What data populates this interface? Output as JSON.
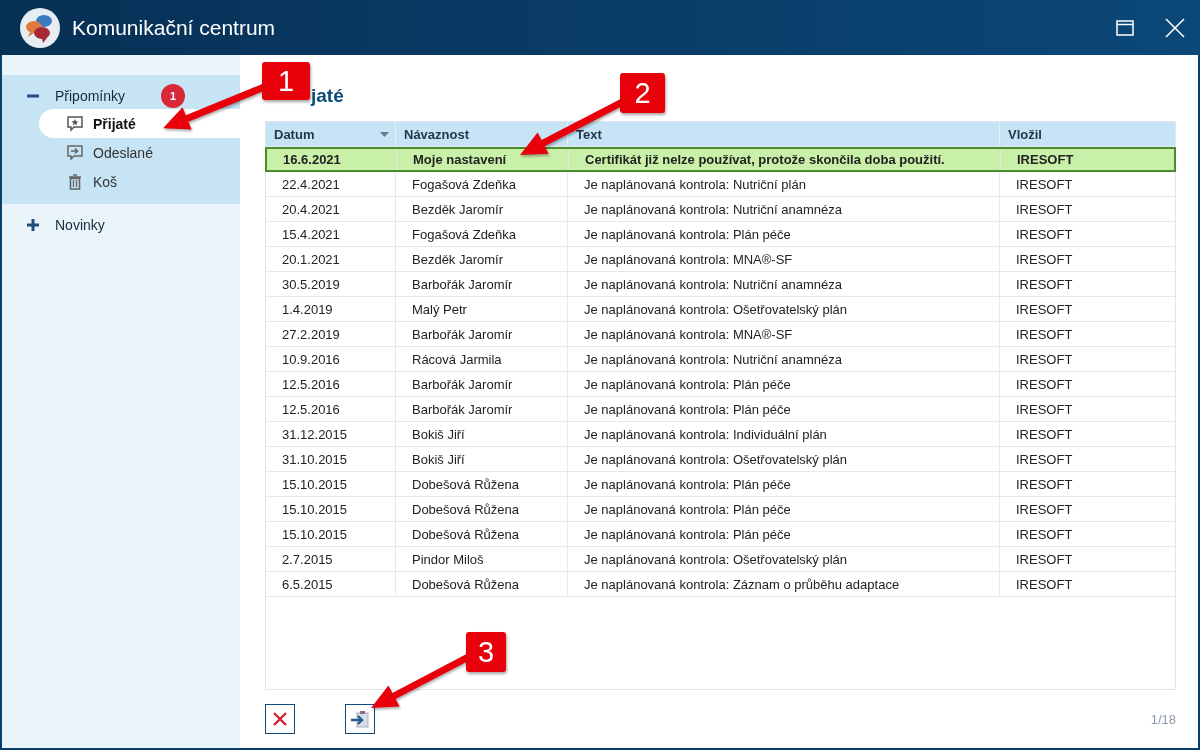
{
  "window": {
    "title": "Komunikační centrum"
  },
  "sidebar": {
    "groups": [
      {
        "label": "Připomínky",
        "expanded": true,
        "badge": "1",
        "children": [
          {
            "label": "Přijaté",
            "kind": "inbox",
            "selected": true
          },
          {
            "label": "Odeslané",
            "kind": "outbox",
            "selected": false
          },
          {
            "label": "Koš",
            "kind": "trash",
            "selected": false
          }
        ]
      },
      {
        "label": "Novinky",
        "expanded": false
      }
    ]
  },
  "heading": "jaté",
  "table": {
    "columns": [
      {
        "label": "Datum",
        "sorted": true
      },
      {
        "label": "Návaznost",
        "sorted": false
      },
      {
        "label": "Text",
        "sorted": false
      },
      {
        "label": "Vložil",
        "sorted": false
      }
    ],
    "rows": [
      {
        "cells": [
          "16.6.2021",
          "Moje nastavení",
          "Certifikát již nelze používat, protože skončila doba použití.",
          "IRESOFT"
        ],
        "selected": true
      },
      {
        "cells": [
          "22.4.2021",
          "Fogašová Zdeňka",
          "Je naplánovaná kontrola: Nutriční plán",
          "IRESOFT"
        ],
        "selected": false
      },
      {
        "cells": [
          "20.4.2021",
          "Bezděk Jaromír",
          "Je naplánovaná kontrola: Nutriční anamnéza",
          "IRESOFT"
        ],
        "selected": false
      },
      {
        "cells": [
          "15.4.2021",
          "Fogašová Zdeňka",
          "Je naplánovaná kontrola: Plán péče",
          "IRESOFT"
        ],
        "selected": false
      },
      {
        "cells": [
          "20.1.2021",
          "Bezděk Jaromír",
          "Je naplánovaná kontrola: MNA®-SF",
          "IRESOFT"
        ],
        "selected": false
      },
      {
        "cells": [
          "30.5.2019",
          "Barbořák Jaromír",
          "Je naplánovaná kontrola: Nutriční anamnéza",
          "IRESOFT"
        ],
        "selected": false
      },
      {
        "cells": [
          "1.4.2019",
          "Malý Petr",
          "Je naplánovaná kontrola: Ošetřovatelský plán",
          "IRESOFT"
        ],
        "selected": false
      },
      {
        "cells": [
          "27.2.2019",
          "Barbořák Jaromír",
          "Je naplánovaná kontrola: MNA®-SF",
          "IRESOFT"
        ],
        "selected": false
      },
      {
        "cells": [
          "10.9.2016",
          "Rácová Jarmila",
          "Je naplánovaná kontrola: Nutriční anamnéza",
          "IRESOFT"
        ],
        "selected": false
      },
      {
        "cells": [
          "12.5.2016",
          "Barbořák Jaromír",
          "Je naplánovaná kontrola: Plán péče",
          "IRESOFT"
        ],
        "selected": false
      },
      {
        "cells": [
          "12.5.2016",
          "Barbořák Jaromír",
          "Je naplánovaná kontrola: Plán péče",
          "IRESOFT"
        ],
        "selected": false
      },
      {
        "cells": [
          "31.12.2015",
          "Bokiš Jiří",
          "Je naplánovaná kontrola: Individuální plán",
          "IRESOFT"
        ],
        "selected": false
      },
      {
        "cells": [
          "31.10.2015",
          "Bokiš Jiří",
          "Je naplánovaná kontrola: Ošetřovatelský plán",
          "IRESOFT"
        ],
        "selected": false
      },
      {
        "cells": [
          "15.10.2015",
          "Dobešová Růžena",
          "Je naplánovaná kontrola: Plán péče",
          "IRESOFT"
        ],
        "selected": false
      },
      {
        "cells": [
          "15.10.2015",
          "Dobešová Růžena",
          "Je naplánovaná kontrola: Plán péče",
          "IRESOFT"
        ],
        "selected": false
      },
      {
        "cells": [
          "15.10.2015",
          "Dobešová Růžena",
          "Je naplánovaná kontrola: Plán péče",
          "IRESOFT"
        ],
        "selected": false
      },
      {
        "cells": [
          "2.7.2015",
          "Pindor Miloš",
          "Je naplánovaná kontrola: Ošetřovatelský plán",
          "IRESOFT"
        ],
        "selected": false
      },
      {
        "cells": [
          "6.5.2015",
          "Dobešová Růžena",
          "Je naplánovaná kontrola: Záznam o průběhu adaptace",
          "IRESOFT"
        ],
        "selected": false
      }
    ]
  },
  "pager": "1/18",
  "callouts": [
    {
      "label": "1"
    },
    {
      "label": "2"
    },
    {
      "label": "3"
    }
  ]
}
